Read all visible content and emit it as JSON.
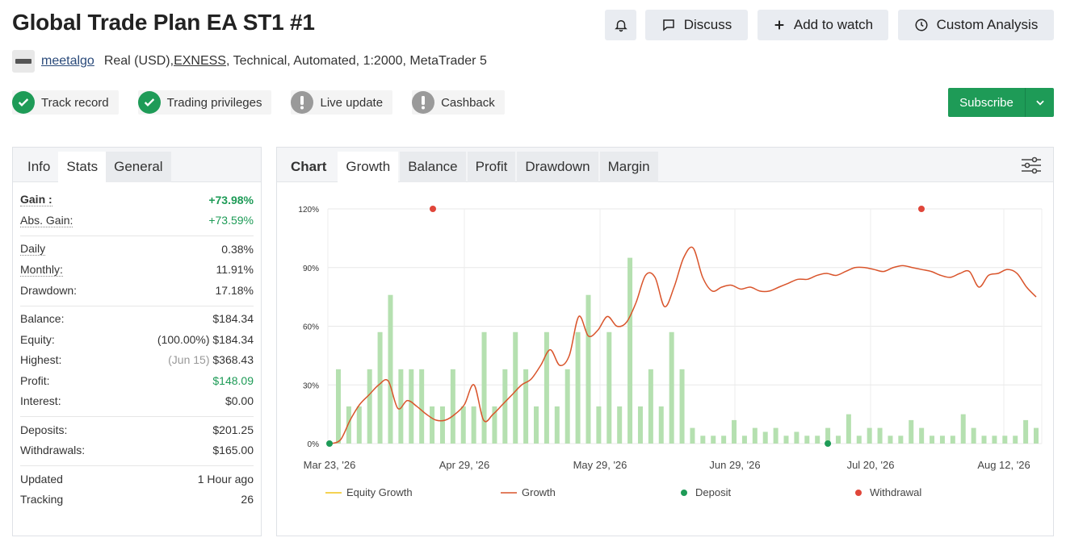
{
  "header": {
    "title": "Global Trade Plan EA ST1 #1",
    "discuss_label": "Discuss",
    "watch_label": "Add to watch",
    "analysis_label": "Custom Analysis",
    "bell_icon": "bell-icon"
  },
  "meta": {
    "username": "meetalgo",
    "account": "Real (USD), ",
    "broker": "EXNESS",
    "details": ", Technical, Automated, 1:2000, MetaTrader 5"
  },
  "badges": [
    {
      "label": "Track record",
      "status": "ok"
    },
    {
      "label": "Trading privileges",
      "status": "ok"
    },
    {
      "label": "Live update",
      "status": "warn"
    },
    {
      "label": "Cashback",
      "status": "warn"
    }
  ],
  "subscribe_label": "Subscribe",
  "left_tabs": [
    "Info",
    "Stats",
    "General"
  ],
  "stats": {
    "gain_label": "Gain :",
    "gain": "+73.98%",
    "abs_gain_label": "Abs. Gain:",
    "abs_gain": "+73.59%",
    "daily_label": "Daily",
    "daily": "0.38%",
    "monthly_label": "Monthly:",
    "monthly": "11.91%",
    "drawdown_label": "Drawdown:",
    "drawdown": "17.18%",
    "balance_label": "Balance:",
    "balance": "$184.34",
    "equity_label": "Equity:",
    "equity_pct": "(100.00%)",
    "equity": "$184.34",
    "highest_label": "Highest:",
    "highest_date": "(Jun 15)",
    "highest": "$368.43",
    "profit_label": "Profit:",
    "profit": "$148.09",
    "interest_label": "Interest:",
    "interest": "$0.00",
    "deposits_label": "Deposits:",
    "deposits": "$201.25",
    "withdrawals_label": "Withdrawals:",
    "withdrawals": "$165.00",
    "updated_label": "Updated",
    "updated": "1 Hour ago",
    "tracking_label": "Tracking",
    "tracking": "26"
  },
  "chart_tabs": [
    "Chart",
    "Growth",
    "Balance",
    "Profit",
    "Drawdown",
    "Margin"
  ],
  "colors": {
    "accent_green": "#1e9b57",
    "growth_line": "#d9542b",
    "bars": "#b5e0b0",
    "equity_line": "#f0c419",
    "deposit": "#1e9b57",
    "withdrawal": "#e0463a"
  },
  "chart_data": {
    "type": "bar",
    "y_ticks": [
      "0%",
      "30%",
      "60%",
      "90%",
      "120%"
    ],
    "ylim": [
      0,
      120
    ],
    "x_ticks": [
      "Mar 23, '26",
      "Apr 29, '26",
      "May 29, '26",
      "Jun 29, '26",
      "Jul 20, '26",
      "Aug 12, '26"
    ],
    "bars": [
      38,
      19,
      19,
      38,
      57,
      76,
      38,
      38,
      38,
      19,
      19,
      38,
      19,
      19,
      57,
      19,
      38,
      57,
      38,
      19,
      57,
      19,
      38,
      57,
      76,
      19,
      57,
      19,
      95,
      19,
      38,
      19,
      57,
      38,
      8,
      4,
      4,
      4,
      12,
      4,
      8,
      6,
      8,
      4,
      6,
      4,
      4,
      8,
      4,
      15,
      4,
      8,
      8,
      4,
      4,
      12,
      8,
      4,
      4,
      4,
      15,
      8,
      4,
      4,
      4,
      4,
      12,
      8
    ],
    "growth": [
      0,
      2,
      12,
      20,
      25,
      30,
      32,
      18,
      22,
      19,
      15,
      12,
      12,
      15,
      20,
      30,
      12,
      15,
      20,
      25,
      30,
      33,
      40,
      48,
      40,
      45,
      65,
      55,
      58,
      65,
      60,
      62,
      72,
      86,
      85,
      70,
      80,
      95,
      100,
      85,
      78,
      80,
      81,
      79,
      80,
      78,
      78,
      80,
      82,
      84,
      84,
      86,
      87,
      86,
      88,
      90,
      90,
      89,
      88,
      90,
      91,
      90,
      89,
      88,
      86,
      85,
      87,
      88,
      80,
      86,
      87,
      89,
      87,
      80,
      75
    ],
    "series": [
      {
        "name": "Equity Growth"
      },
      {
        "name": "Growth"
      },
      {
        "name": "Deposit"
      },
      {
        "name": "Withdrawal"
      }
    ],
    "deposits_x": [
      0,
      47
    ],
    "withdrawals_x": [
      10,
      49
    ]
  }
}
